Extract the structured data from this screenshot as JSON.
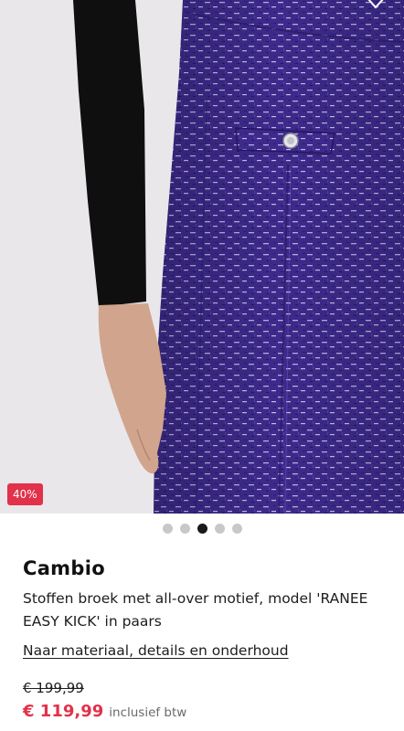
{
  "product": {
    "discount_badge": "40%",
    "brand": "Cambio",
    "title": "Stoffen broek met all-over motief, model 'RANEE EASY KICK' in paars",
    "details_link": "Naar materiaal, details en onderhoud",
    "old_price": "€ 199,99",
    "new_price": "€ 119,99",
    "vat_note": "inclusief btw"
  },
  "gallery": {
    "total_images": 5,
    "active_index": 2
  },
  "colors": {
    "accent_red": "#e2314a",
    "fabric_purple": "#3f2a8f"
  },
  "icons": {
    "wishlist": "heart-icon"
  }
}
